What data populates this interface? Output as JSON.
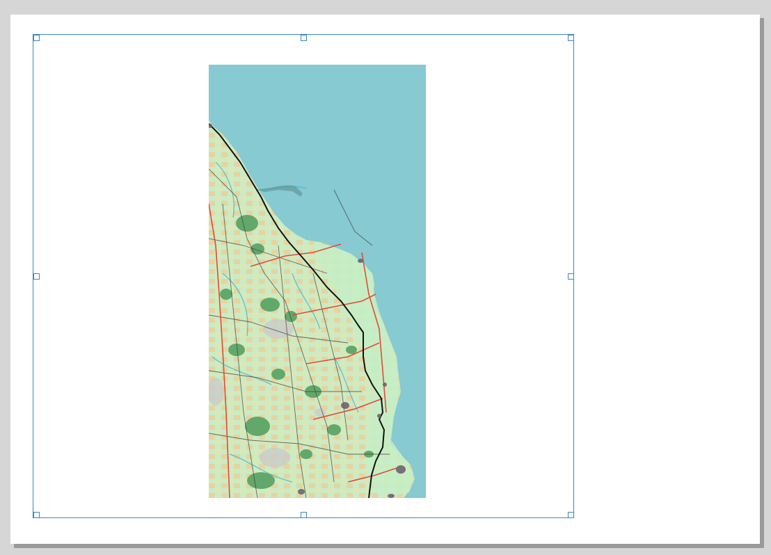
{
  "window": {
    "background_color": "#d6d6d6"
  },
  "layout_page": {
    "paper_color": "#ffffff",
    "shadow_color": "#9a9a9a"
  },
  "map_item": {
    "selected": true,
    "selection_color": "#3a85c4",
    "handles": [
      "top-left",
      "top-center",
      "top-right",
      "middle-left",
      "middle-right",
      "bottom-left",
      "bottom-center",
      "bottom-right"
    ]
  },
  "map_render": {
    "sea_color": "#87cad1",
    "land_color": "#c6ecc4",
    "farmland_color": "#e6cf98",
    "forest_color": "#62a86a",
    "road_major_color": "#e04a3a",
    "road_minor_color": "#3c3c3c",
    "railway_color": "#111111",
    "urban_color": "#6b5a6a",
    "water_color": "#45b9d6"
  }
}
